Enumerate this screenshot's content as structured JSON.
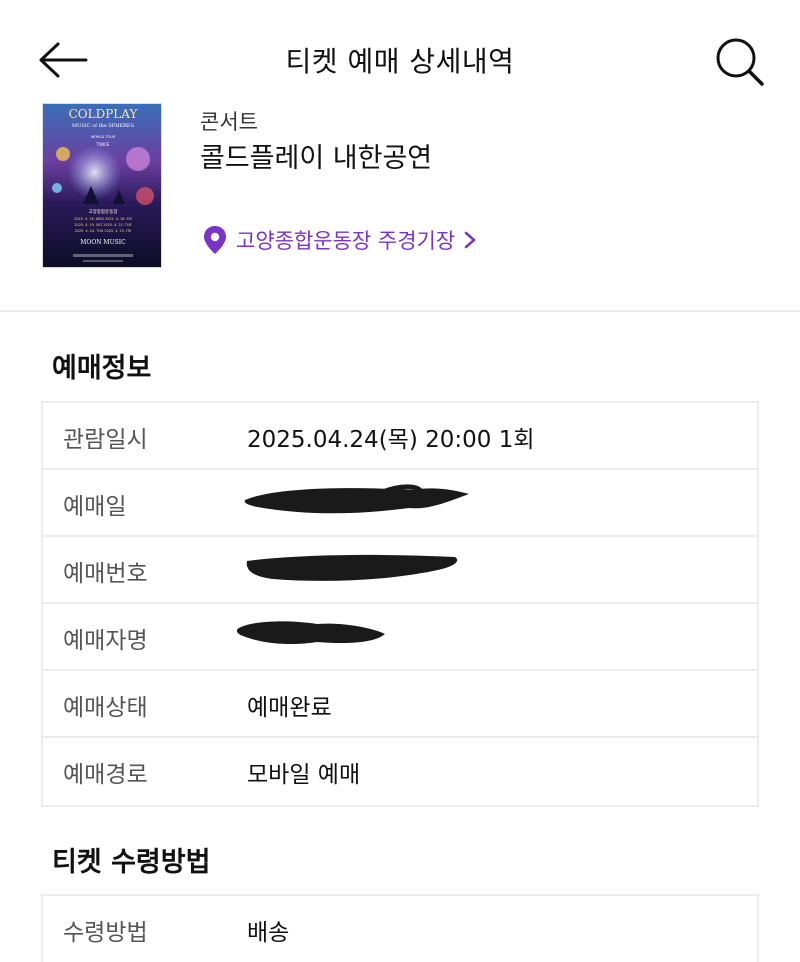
{
  "header": {
    "title": "티켓 예매 상세내역",
    "back_icon": "arrow-left-icon",
    "search_icon": "search-icon"
  },
  "event": {
    "category": "콘서트",
    "name": "콜드플레이 내한공연",
    "venue": "고양종합운동장 주경기장",
    "venue_color": "#7a34c9",
    "poster": {
      "title": "COLDPLAY",
      "subtitle": "MUSIC of the SPHERES",
      "tour": "WORLD TOUR",
      "special_guest": "TWICE",
      "venue_korean": "고양종합운동장",
      "dates": [
        "2025. 4. 16. WED   2025. 4. 18. FRI",
        "2025. 4. 19. SAT   2025. 4. 22. TUE",
        "2025. 4. 24. THU   2025. 4. 25. FRI"
      ],
      "album": "MOON MUSIC"
    }
  },
  "booking_info": {
    "title": "예매정보",
    "rows": [
      {
        "label": "관람일시",
        "value": "2025.04.24(목) 20:00 1회"
      },
      {
        "label": "예매일",
        "value": ""
      },
      {
        "label": "예매번호",
        "value": ""
      },
      {
        "label": "예매자명",
        "value": ""
      },
      {
        "label": "예매상태",
        "value": "예매완료"
      },
      {
        "label": "예매경로",
        "value": "모바일 예매"
      }
    ]
  },
  "ticket_receipt": {
    "title": "티켓 수령방법",
    "rows": [
      {
        "label": "수령방법",
        "value": "배송"
      }
    ]
  }
}
